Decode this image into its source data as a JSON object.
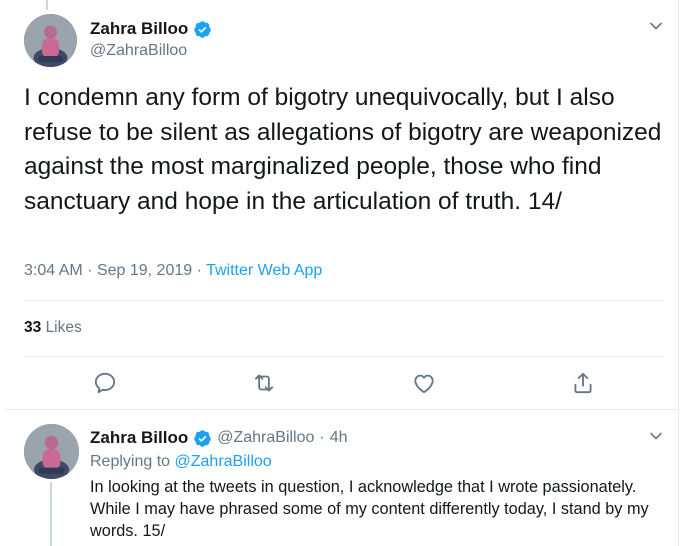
{
  "tweet": {
    "author_name": "Zahra Billoo",
    "author_handle": "@ZahraBilloo",
    "text": "I condemn any form of bigotry unequivocally, but I also refuse to be silent as allegations of bigotry are weaponized against the most marginalized people, those who find sanctuary and hope in the articulation of truth. 14/",
    "time": "3:04 AM",
    "date": "Sep 19, 2019",
    "dot": "·",
    "source": "Twitter Web App",
    "likes_count": "33",
    "likes_label": "Likes"
  },
  "reply": {
    "author_name": "Zahra Billoo",
    "author_handle": "@ZahraBilloo",
    "age": "4h",
    "replying_to_label": "Replying to",
    "replying_to_handle": "@ZahraBilloo",
    "text": "In looking at the tweets in question, I acknowledge that I wrote passionately. While I may have phrased some of my content differently today, I stand by my words. 15/"
  },
  "icons": {
    "verified": "verified-badge-icon",
    "more": "chevron-down-icon",
    "reply": "reply-icon",
    "retweet": "retweet-icon",
    "like": "heart-icon",
    "share": "share-icon"
  },
  "colors": {
    "accent": "#1da1f2",
    "text": "#14171a",
    "secondary": "#657786",
    "divider": "#e6ecf0"
  }
}
